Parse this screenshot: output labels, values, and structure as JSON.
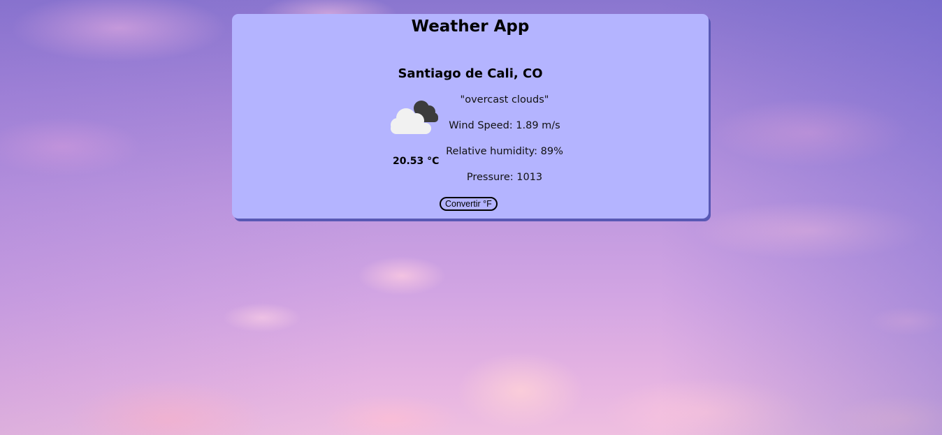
{
  "app": {
    "title": "Weather App"
  },
  "location": {
    "city": "Santiago de Cali, CO"
  },
  "weather": {
    "icon": "overcast-clouds-icon",
    "temperature": "20.53 °C",
    "description": "\"overcast clouds\"",
    "wind_speed": "Wind Speed: 1.89 m/s",
    "humidity": "Relative humidity: 89%",
    "pressure": "Pressure: 1013"
  },
  "actions": {
    "convert_label": "Convertir °F"
  },
  "colors": {
    "card_background": "#b4b4ff",
    "card_shadow": "#5858b4"
  }
}
